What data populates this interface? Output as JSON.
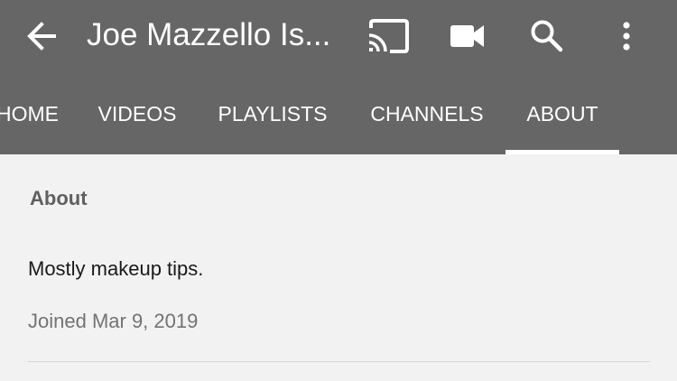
{
  "appbar": {
    "title": "Joe Mazzello Is...",
    "back_icon": "arrow-back-icon",
    "cast_icon": "cast-icon",
    "video_icon": "videocam-icon",
    "search_icon": "search-icon",
    "more_icon": "more-vert-icon"
  },
  "tabs": [
    {
      "label": "HOME",
      "selected": false
    },
    {
      "label": "VIDEOS",
      "selected": false
    },
    {
      "label": "PLAYLISTS",
      "selected": false
    },
    {
      "label": "CHANNELS",
      "selected": false
    },
    {
      "label": "ABOUT",
      "selected": true
    }
  ],
  "about": {
    "section_title": "About",
    "description": "Mostly makeup tips.",
    "joined": "Joined Mar 9, 2019"
  },
  "colors": {
    "appbar_bg": "#666666",
    "page_bg": "#f2f2f2",
    "text_primary": "#1a1a1a",
    "text_secondary": "#737373"
  }
}
